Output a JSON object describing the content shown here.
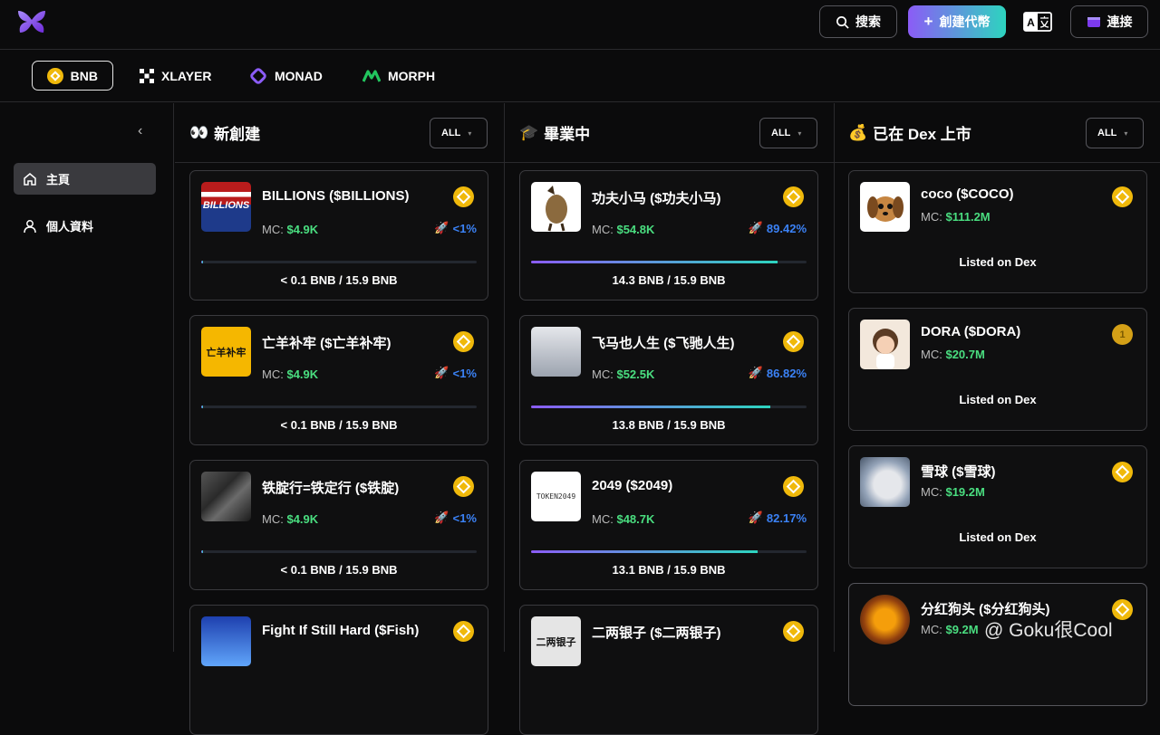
{
  "header": {
    "search_label": "搜索",
    "create_label": "創建代幣",
    "connect_label": "連接"
  },
  "chains": [
    {
      "label": "BNB",
      "active": true
    },
    {
      "label": "XLAYER",
      "active": false
    },
    {
      "label": "MONAD",
      "active": false
    },
    {
      "label": "MORPH",
      "active": false
    }
  ],
  "sidebar": {
    "items": [
      {
        "label": "主頁",
        "active": true
      },
      {
        "label": "個人資料",
        "active": false
      }
    ]
  },
  "columns": [
    {
      "emoji": "👀",
      "title": "新創建",
      "filter": "ALL",
      "cards": [
        {
          "name": "BILLIONS ($BILLIONS)",
          "mc_label": "MC:",
          "mc": "$4.9K",
          "pct": "<1%",
          "progress": 0.005,
          "amount": "< 0.1 BNB / 15.9 BNB"
        },
        {
          "name": "亡羊补牢 ($亡羊补牢)",
          "mc_label": "MC:",
          "mc": "$4.9K",
          "pct": "<1%",
          "progress": 0.005,
          "amount": "< 0.1 BNB / 15.9 BNB",
          "thumb_text": "亡羊补牢"
        },
        {
          "name": "铁腚行=铁定行 ($铁腚)",
          "mc_label": "MC:",
          "mc": "$4.9K",
          "pct": "<1%",
          "progress": 0.005,
          "amount": "< 0.1 BNB / 15.9 BNB"
        },
        {
          "name": "Fight If Still Hard ($Fish)"
        }
      ]
    },
    {
      "emoji": "🎓",
      "title": "畢業中",
      "filter": "ALL",
      "cards": [
        {
          "name": "功夫小马 ($功夫小马)",
          "mc_label": "MC:",
          "mc": "$54.8K",
          "pct": "89.42%",
          "progress": 0.8942,
          "amount": "14.3 BNB / 15.9 BNB"
        },
        {
          "name": "飞马也人生 ($飞驰人生)",
          "mc_label": "MC:",
          "mc": "$52.5K",
          "pct": "86.82%",
          "progress": 0.8682,
          "amount": "13.8 BNB / 15.9 BNB"
        },
        {
          "name": "2049 ($2049)",
          "mc_label": "MC:",
          "mc": "$48.7K",
          "pct": "82.17%",
          "progress": 0.8217,
          "amount": "13.1 BNB / 15.9 BNB",
          "thumb_text": "TOKEN2049"
        },
        {
          "name": "二两银子 ($二两银子)",
          "thumb_text": "二两银子"
        }
      ]
    },
    {
      "emoji": "💰",
      "title": "已在 Dex 上市",
      "filter": "ALL",
      "cards": [
        {
          "name": "coco ($COCO)",
          "mc_label": "MC:",
          "mc": "$111.2M",
          "status": "Listed on Dex"
        },
        {
          "name": "DORA ($DORA)",
          "mc_label": "MC:",
          "mc": "$20.7M",
          "status": "Listed on Dex"
        },
        {
          "name": "雪球 ($雪球)",
          "mc_label": "MC:",
          "mc": "$19.2M",
          "status": "Listed on Dex"
        },
        {
          "name": "分红狗头 ($分红狗头)",
          "mc_label": "MC:",
          "mc": "$9.2M"
        }
      ]
    }
  ],
  "watermark": "@ Goku很Cool",
  "colors": {
    "accent_green": "#4ade80",
    "accent_blue": "#3b82f6",
    "bnb_yellow": "#f0b90b",
    "gradient_start": "#8b5cf6",
    "gradient_end": "#2dd4bf"
  }
}
